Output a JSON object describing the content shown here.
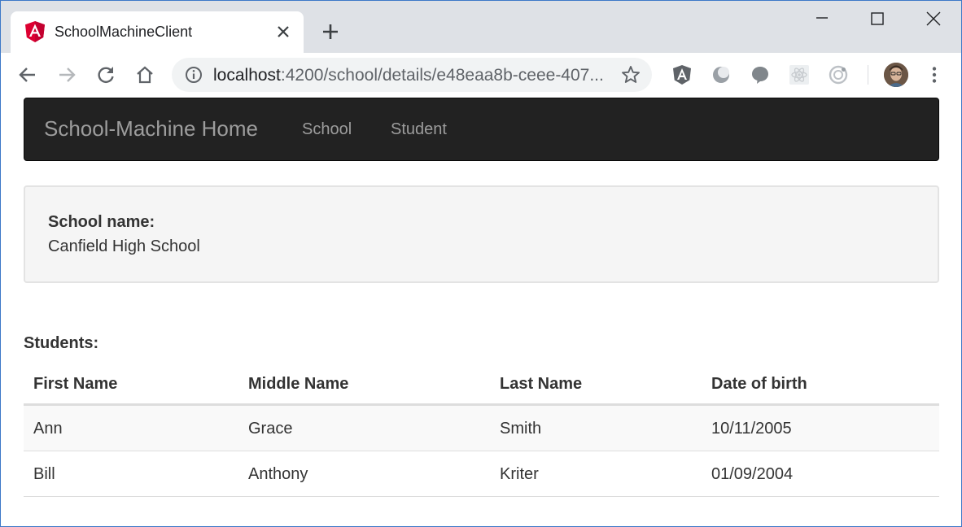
{
  "browser": {
    "tab": {
      "title": "SchoolMachineClient",
      "favicon": "angular-icon"
    },
    "address_bar": {
      "host": "localhost",
      "path": ":4200/school/details/e48eaa8b-ceee-407..."
    },
    "accent_colors": {
      "tabstrip": "#dee1e6",
      "omnibox": "#f1f3f4"
    }
  },
  "navbar": {
    "brand": "School-Machine Home",
    "links": [
      "School",
      "Student"
    ],
    "background": "#222222"
  },
  "school": {
    "label": "School name:",
    "name": "Canfield High School"
  },
  "students": {
    "heading": "Students:",
    "columns": [
      "First Name",
      "Middle Name",
      "Last Name",
      "Date of birth"
    ],
    "rows": [
      [
        "Ann",
        "Grace",
        "Smith",
        "10/11/2005"
      ],
      [
        "Bill",
        "Anthony",
        "Kriter",
        "01/09/2004"
      ]
    ]
  }
}
